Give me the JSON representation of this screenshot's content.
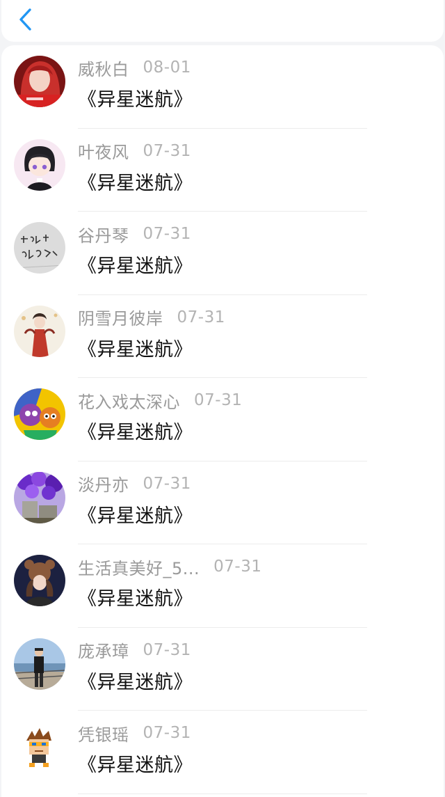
{
  "header": {
    "back_icon": "chevron-left-icon",
    "accent_color": "#2196f3"
  },
  "items": [
    {
      "name": "威秋白",
      "date": "08-01",
      "title": "《异星迷航》",
      "avatar": "avatar-red-hair-woman"
    },
    {
      "name": "叶夜风",
      "date": "07-31",
      "title": "《异星迷航》",
      "avatar": "avatar-anime-girl"
    },
    {
      "name": "谷丹琴",
      "date": "07-31",
      "title": "《异星迷航》",
      "avatar": "avatar-calligraphy"
    },
    {
      "name": "阴雪月彼岸",
      "date": "07-31",
      "title": "《异星迷航》",
      "avatar": "avatar-costume-figure"
    },
    {
      "name": "花入戏太深心",
      "date": "07-31",
      "title": "《异星迷航》",
      "avatar": "avatar-cartoon-characters"
    },
    {
      "name": "淡丹亦",
      "date": "07-31",
      "title": "《异星迷航》",
      "avatar": "avatar-purple-blossoms"
    },
    {
      "name": "生活真美好_5...",
      "date": "07-31",
      "title": "《异星迷航》",
      "avatar": "avatar-bear-ears-girl"
    },
    {
      "name": "庞承璋",
      "date": "07-31",
      "title": "《异星迷航》",
      "avatar": "avatar-seaside-boy"
    },
    {
      "name": "凭银瑶",
      "date": "07-31",
      "title": "《异星迷航》",
      "avatar": "avatar-pixel-character"
    }
  ]
}
